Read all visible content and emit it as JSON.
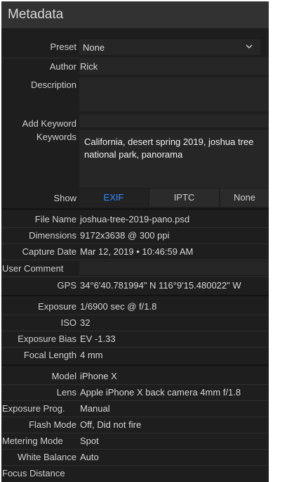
{
  "panel": {
    "title": "Metadata"
  },
  "preset": {
    "label": "Preset",
    "value": "None"
  },
  "author": {
    "label": "Author",
    "value": "Rick"
  },
  "description": {
    "label": "Description",
    "value": ""
  },
  "add_keyword": {
    "label": "Add Keyword",
    "value": ""
  },
  "keywords": {
    "label": "Keywords",
    "value": "California, desert spring 2019, joshua tree national park, panorama"
  },
  "show": {
    "label": "Show",
    "options": [
      "EXIF",
      "IPTC",
      "None"
    ],
    "selected": "EXIF",
    "active_color": "#2f8cff"
  },
  "file_info": [
    {
      "label": "File Name",
      "value": "joshua-tree-2019-pano.psd"
    },
    {
      "label": "Dimensions",
      "value": "9172x3638 @ 300 ppi"
    },
    {
      "label": "Capture Date",
      "value": "Mar 12, 2019 • 10:46:59 AM"
    },
    {
      "label": "User Comment",
      "value": ""
    },
    {
      "label": "GPS",
      "value": "34°6'40.781994\" N 116°9'15.480022\" W"
    }
  ],
  "exposure_info": [
    {
      "label": "Exposure",
      "value": "1/6900 sec @ f/1.8"
    },
    {
      "label": "ISO",
      "value": "32"
    },
    {
      "label": "Exposure Bias",
      "value": "EV -1.33"
    },
    {
      "label": "Focal Length",
      "value": "4 mm"
    }
  ],
  "camera_info": [
    {
      "label": "Model",
      "value": "iPhone X"
    },
    {
      "label": "Lens",
      "value": "Apple iPhone X back camera 4mm f/1.8"
    },
    {
      "label": "Exposure Prog.",
      "value": "Manual"
    },
    {
      "label": "Flash Mode",
      "value": "Off, Did not fire"
    },
    {
      "label": "Metering Mode",
      "value": "Spot"
    },
    {
      "label": "White Balance",
      "value": "Auto"
    },
    {
      "label": "Focus Distance",
      "value": ""
    }
  ],
  "colors": {
    "panel_bg": "#1e1e1e",
    "header_bg": "#323232",
    "field_bg": "#262626",
    "accent": "#2f8cff"
  }
}
